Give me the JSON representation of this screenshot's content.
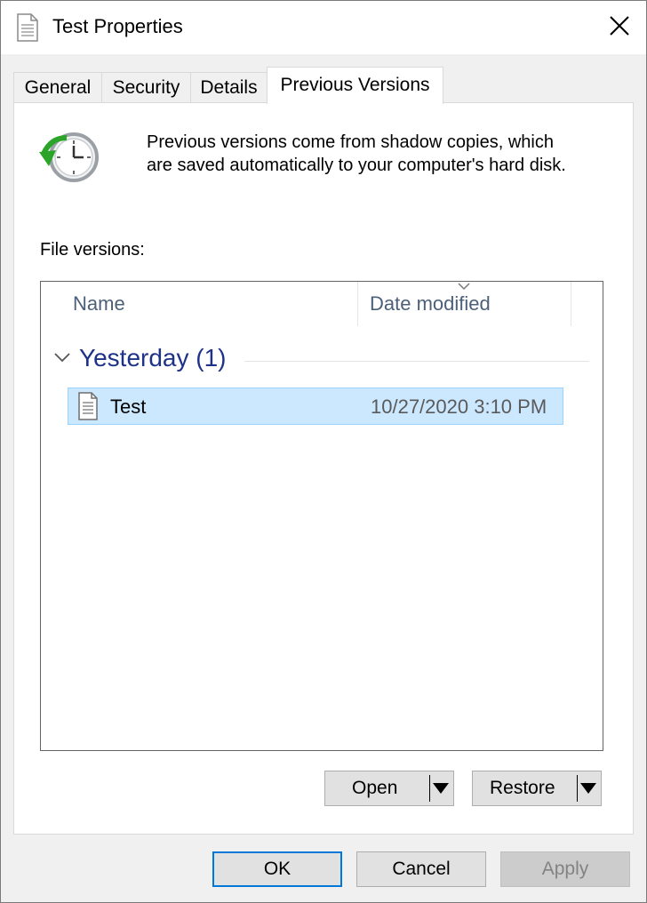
{
  "window": {
    "title": "Test Properties"
  },
  "tabs": [
    {
      "label": "General",
      "active": false
    },
    {
      "label": "Security",
      "active": false
    },
    {
      "label": "Details",
      "active": false
    },
    {
      "label": "Previous Versions",
      "active": true
    }
  ],
  "description": {
    "line1": "Previous versions come from shadow copies, which",
    "line2": "are saved automatically to your computer's hard disk."
  },
  "file_versions": {
    "label": "File versions:",
    "columns": {
      "name": "Name",
      "date": "Date modified"
    },
    "groups": [
      {
        "label": "Yesterday (1)",
        "items": [
          {
            "name": "Test",
            "date": "10/27/2020 3:10 PM",
            "selected": true
          }
        ]
      }
    ]
  },
  "actions": {
    "open": "Open",
    "restore": "Restore"
  },
  "footer": {
    "ok": "OK",
    "cancel": "Cancel",
    "apply": "Apply"
  },
  "colors": {
    "selection_bg": "#cce8ff",
    "selection_border": "#99d1ff",
    "group_header": "#1e3287",
    "default_button_border": "#0078d7"
  }
}
